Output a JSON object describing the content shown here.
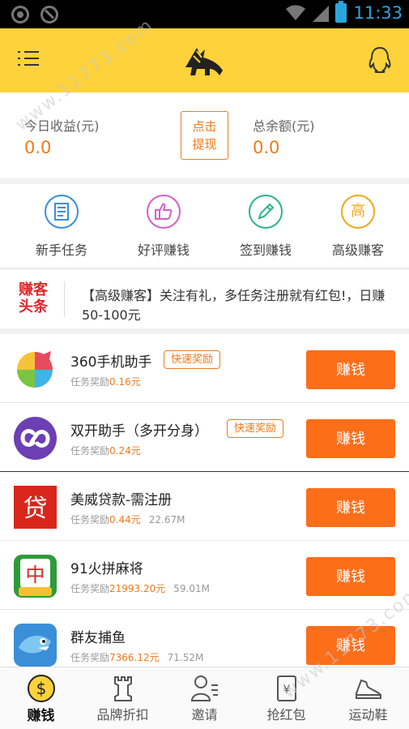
{
  "status_bar": {
    "time": "11:33"
  },
  "header": {
    "menu_icon": "menu-icon",
    "logo": "horse-logo",
    "support_icon": "qq-penguin-icon"
  },
  "earnings": {
    "today_label": "今日收益(元)",
    "today_value": "0.0",
    "withdraw_line1": "点击",
    "withdraw_line2": "提现",
    "balance_label": "总余额(元)",
    "balance_value": "0.0"
  },
  "categories": [
    {
      "label": "新手任务",
      "icon": "newspaper-icon",
      "color": "#3a8ed8"
    },
    {
      "label": "好评赚钱",
      "icon": "thumbs-up-icon",
      "color": "#d65fc9"
    },
    {
      "label": "签到赚钱",
      "icon": "pencil-icon",
      "color": "#2bb58a"
    },
    {
      "label": "高级赚客",
      "icon": "gao-icon",
      "glyph": "高",
      "color": "#f0a81a"
    }
  ],
  "news": {
    "logo_line1": "赚客",
    "logo_line2": "头条",
    "text": "【高级赚客】关注有礼，多任务注册就有红包!，日赚50-100元"
  },
  "tasks": [
    {
      "name": "360手机助手",
      "badge": "快速奖励",
      "reward_label": "任务奖励",
      "reward": "0.16元",
      "size": "",
      "button": "赚钱"
    },
    {
      "name": "双开助手（多开分身）",
      "badge": "快速奖励",
      "reward_label": "任务奖励",
      "reward": "0.24元",
      "size": "",
      "button": "赚钱"
    },
    {
      "name": "美威贷款-需注册",
      "badge": "",
      "reward_label": "任务奖励",
      "reward": "0.44元",
      "size": "22.67M",
      "button": "赚钱"
    },
    {
      "name": "91火拼麻将",
      "badge": "",
      "reward_label": "任务奖励",
      "reward": "21993.20元",
      "size": "59.01M",
      "button": "赚钱"
    },
    {
      "name": "群友捕鱼",
      "badge": "",
      "reward_label": "任务奖励",
      "reward": "7366.12元",
      "size": "71.52M",
      "button": "赚钱"
    }
  ],
  "bottom_nav": [
    {
      "label": "赚钱",
      "icon": "dollar-coin-icon",
      "active": true
    },
    {
      "label": "品牌折扣",
      "icon": "chess-rook-icon",
      "active": false
    },
    {
      "label": "邀请",
      "icon": "invite-person-icon",
      "active": false
    },
    {
      "label": "抢红包",
      "icon": "red-envelope-icon",
      "active": false
    },
    {
      "label": "运动鞋",
      "icon": "sneaker-icon",
      "active": false
    }
  ],
  "watermark": "www.11773.com",
  "colors": {
    "header": "#fdd23a",
    "accent": "#f07a1c",
    "button": "#fc6e1a"
  }
}
